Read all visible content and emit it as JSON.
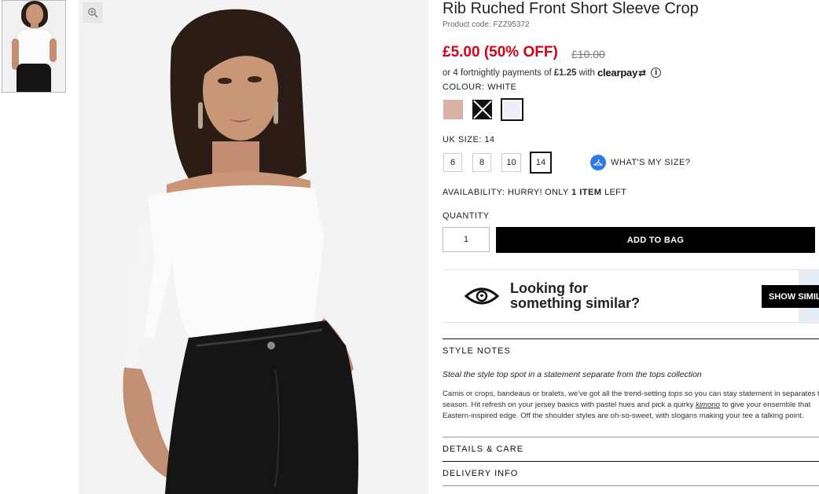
{
  "product": {
    "title": "Rib Ruched Front Short Sleeve Crop",
    "code": "Product code: FZZ95372",
    "price_now": "£5.00 (50% OFF)",
    "price_was": "£10.00"
  },
  "clearpay": {
    "prefix": "or 4 fortnightly payments of",
    "amount": "£1.25",
    "with": "with",
    "brand": "clearpay",
    "brand_mark": "⇄",
    "info": "i"
  },
  "colour": {
    "label": "COLOUR:",
    "value": "WHITE",
    "swatches": [
      "pink",
      "black",
      "white"
    ]
  },
  "size": {
    "label": "UK SIZE:",
    "value": "14",
    "options": [
      "6",
      "8",
      "10",
      "14"
    ],
    "guide": "WHAT'S MY SIZE?"
  },
  "availability": {
    "label": "AVAILABILITY:",
    "prefix": "HURRY! ONLY",
    "count": "1 ITEM",
    "suffix": "LEFT"
  },
  "quantity": {
    "label": "QUANTITY",
    "value": "1"
  },
  "add_to_bag": "ADD TO BAG",
  "similar": {
    "line1": "Looking for",
    "line2": "something similar?",
    "button": "SHOW SIMILAR"
  },
  "style_notes": {
    "heading": "STYLE NOTES",
    "lead": "Steal the style top spot in a statement separate from the tops collection",
    "line1_a": "Camis or crops, bandeaus or bralets, we've got all the trend-setting",
    "line1_link": "tops",
    "line1_b": "so you can stay statement in separates this",
    "line2_a": "season. Hit refresh on your jersey basics with pastel hues and pick a quirky",
    "line2_link": "kimono",
    "line2_b": "to give your ensemble that",
    "line3": "Eastern-inspired edge. Off the shoulder styles are oh-so-sweet, with slogans making your tee a talking point."
  },
  "details_care": "DETAILS & CARE",
  "delivery_info": "DELIVERY INFO",
  "colors": {
    "price_red": "#d0021b",
    "clearpay_blue": "#2f7be6",
    "button_black": "#000000"
  }
}
